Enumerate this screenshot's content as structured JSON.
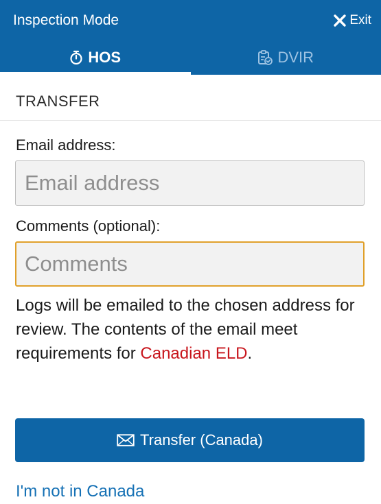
{
  "header": {
    "title": "Inspection Mode",
    "exit_label": "Exit",
    "exit_icon": "close-icon",
    "colors": {
      "bar": "#0e65a6",
      "active_tab": "#ffffff",
      "inactive_tab": "#9ec3e3"
    }
  },
  "tabs": [
    {
      "label": "HOS",
      "icon": "stopwatch-icon",
      "active": true
    },
    {
      "label": "DVIR",
      "icon": "clipboard-check-icon",
      "active": false
    }
  ],
  "section": {
    "title": "TRANSFER"
  },
  "form": {
    "email": {
      "label": "Email address:",
      "placeholder": "Email address",
      "value": ""
    },
    "comments": {
      "label": "Comments (optional):",
      "placeholder": "Comments",
      "value": ""
    }
  },
  "info": {
    "text_before": "Logs will be emailed to the chosen address for review. The contents of the email meet requirements for ",
    "link_text": "Canadian ELD",
    "text_after": ".",
    "link_color": "#c8161d"
  },
  "actions": {
    "transfer_label": "Transfer (Canada)",
    "transfer_icon": "envelope-icon",
    "not_canada_label": "I'm not in Canada"
  }
}
